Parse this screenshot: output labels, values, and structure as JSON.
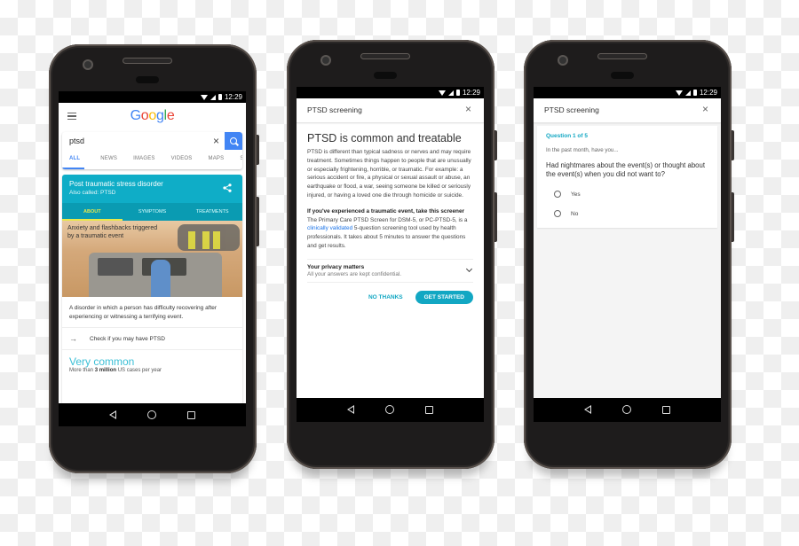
{
  "status_bar": {
    "time": "12:29"
  },
  "phone1": {
    "logo_letters": [
      "G",
      "o",
      "o",
      "g",
      "l",
      "e"
    ],
    "search": {
      "query": "ptsd"
    },
    "tabs": [
      "ALL",
      "NEWS",
      "IMAGES",
      "VIDEOS",
      "MAPS",
      "SHOPPI"
    ],
    "active_tab": "ALL",
    "knowledge_panel": {
      "title": "Post traumatic stress disorder",
      "subtitle": "Also called: PTSD",
      "tabs": [
        "ABOUT",
        "SYMPTOMS",
        "TREATMENTS"
      ],
      "active_tab": "ABOUT",
      "image_caption": "Anxiety and flashbacks triggered by a traumatic event",
      "description": "A disorder in which a person has difficulty recovering after experiencing or witnessing a terrifying event.",
      "link_label": "Check if you may have PTSD",
      "stat_title": "Very common",
      "stat_prefix": "More than ",
      "stat_bold": "3 million",
      "stat_suffix": " US cases per year"
    },
    "colors": {
      "card_header": "#0fadc7",
      "tab_bar": "#0a9bb2",
      "active_tab": "#e8e84a",
      "search_button": "#4285f4"
    }
  },
  "phone2": {
    "dialog_title": "PTSD screening",
    "heading": "PTSD is common and treatable",
    "paragraph1": "PTSD is different than typical sadness or nerves and may require treatment. Sometimes things happen to people that are unusually or especially frightening, horrible, or traumatic. For example: a serious accident or fire, a physical or sexual assault or abuse, an earthquake or flood, a war, seeing someone be killed or seriously injured, or having a loved one die through homicide or suicide.",
    "paragraph2_bold": "If you've experienced a traumatic event, take this screener",
    "paragraph2_a": "The Primary Care PTSD Screen for DSM-5, or PC-PTSD-5, is a ",
    "paragraph2_link": "clinically validated",
    "paragraph2_b": " 5-question screening tool used by health professionals. It takes about 5 minutes to answer the questions and get results.",
    "privacy_title": "Your privacy matters",
    "privacy_subtitle": "All your answers are kept confidential.",
    "secondary_button": "NO THANKS",
    "primary_button": "GET STARTED",
    "colors": {
      "accent": "#12a7c3",
      "link": "#1a73e8"
    }
  },
  "phone3": {
    "dialog_title": "PTSD screening",
    "question_count": "Question 1 of 5",
    "intro": "In the past month, have you...",
    "question": "Had nightmares about the event(s) or thought about the event(s) when you did not want to?",
    "options": [
      "Yes",
      "No"
    ]
  }
}
